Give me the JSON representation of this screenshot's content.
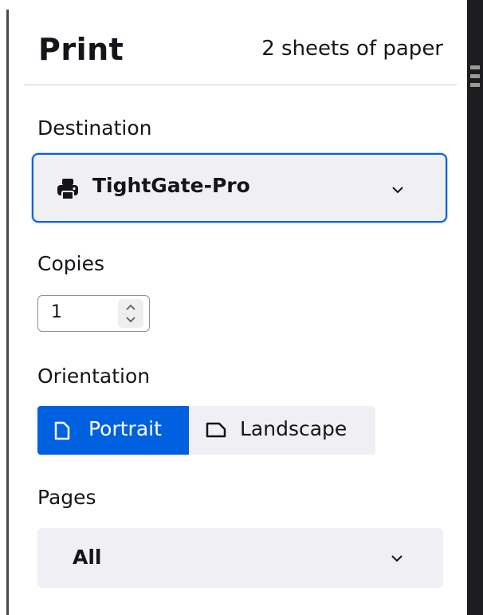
{
  "header": {
    "title": "Print",
    "sheet_count": "2 sheets of paper"
  },
  "destination": {
    "label": "Destination",
    "selected": "TightGate-Pro",
    "icon": "printer-icon"
  },
  "copies": {
    "label": "Copies",
    "value": "1"
  },
  "orientation": {
    "label": "Orientation",
    "options": [
      {
        "label": "Portrait",
        "selected": true,
        "icon": "portrait-page-icon"
      },
      {
        "label": "Landscape",
        "selected": false,
        "icon": "landscape-page-icon"
      }
    ]
  },
  "pages": {
    "label": "Pages",
    "selected": "All"
  },
  "colors": {
    "accent": "#0061e0",
    "field_bg": "#f0f0f4",
    "text": "#15141a",
    "preview_bg": "#1d1d1f"
  }
}
